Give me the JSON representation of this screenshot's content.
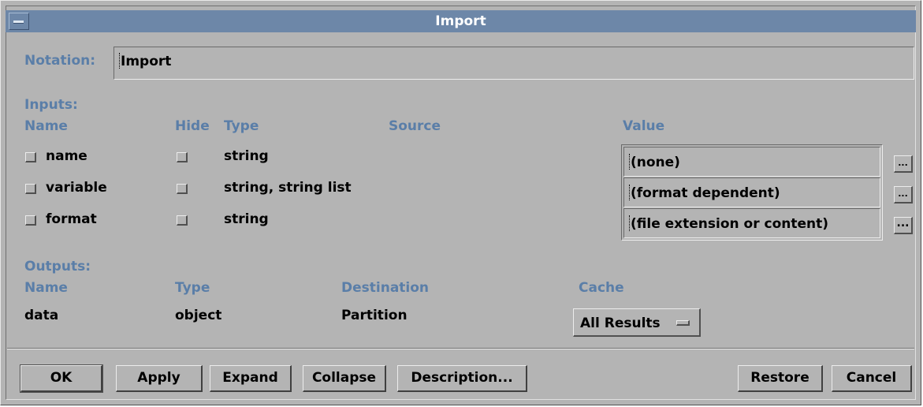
{
  "window": {
    "title": "Import"
  },
  "notation": {
    "label": "Notation:",
    "value": "Import"
  },
  "inputs": {
    "section_label": "Inputs:",
    "headers": {
      "name": "Name",
      "hide": "Hide",
      "type": "Type",
      "source": "Source",
      "value": "Value"
    },
    "rows": [
      {
        "name": "name",
        "type": "string",
        "value": "(none)"
      },
      {
        "name": "variable",
        "type": "string, string list",
        "value": "(format dependent)"
      },
      {
        "name": "format",
        "type": "string",
        "value": "(file extension or content)"
      }
    ],
    "ellipsis": "..."
  },
  "outputs": {
    "section_label": "Outputs:",
    "headers": {
      "name": "Name",
      "type": "Type",
      "destination": "Destination",
      "cache": "Cache"
    },
    "rows": [
      {
        "name": "data",
        "type": "object",
        "destination": "Partition",
        "cache": "All Results"
      }
    ]
  },
  "buttons": {
    "ok": "OK",
    "apply": "Apply",
    "expand": "Expand",
    "collapse": "Collapse",
    "description": "Description...",
    "restore": "Restore",
    "cancel": "Cancel"
  },
  "colors": {
    "background": "#b4b4b4",
    "titlebar": "#6d87a8",
    "label": "#5a7ea8"
  }
}
